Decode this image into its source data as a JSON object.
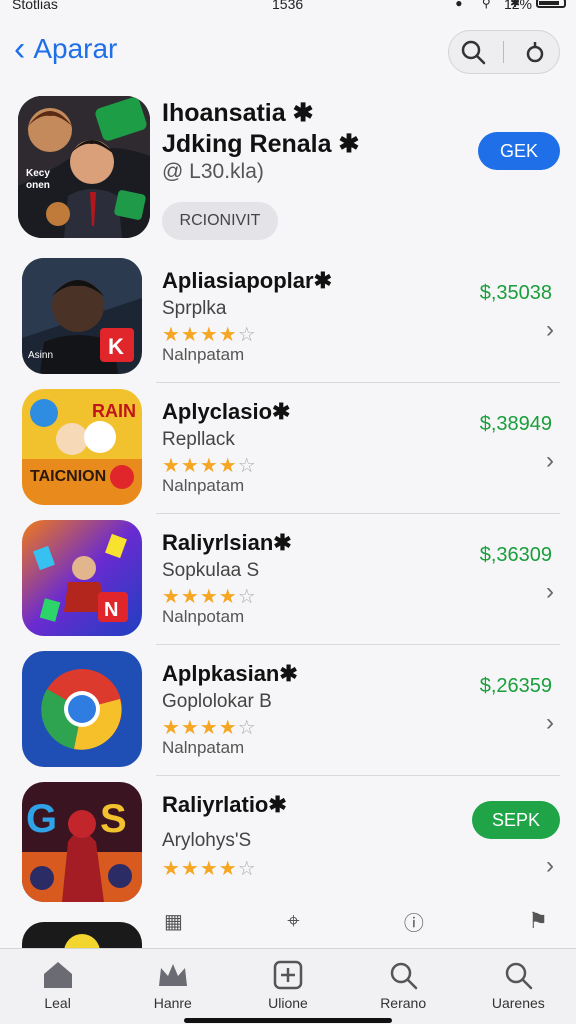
{
  "status_bar": {
    "carrier": "Stotlias",
    "time": "1536",
    "battery": "12%"
  },
  "nav": {
    "back_label": "Aparar",
    "search_icon": "search-icon",
    "account_icon": "account-icon"
  },
  "featured": {
    "title_line1": "Ihoansatia ✱",
    "title_line2": "Jdking Renala ✱",
    "subtitle": "@ L30.kla)",
    "tag": "RCIONIVIT",
    "get_label": "GEK",
    "get_color": "#1e6fe8"
  },
  "apps": [
    {
      "name": "Apliasiapoplar✱",
      "developer": "Sprplka",
      "rating": 4,
      "category": "Nalnpatam",
      "price": "$,35038"
    },
    {
      "name": "Aplyclasio✱",
      "developer": "Repllack",
      "rating": 4,
      "category": "Nalnpatam",
      "price": "$,38949"
    },
    {
      "name": "Raliyrlsian✱",
      "developer": "Sopkulaa S",
      "rating": 4,
      "category": "Nalnpotam",
      "price": "$,36309"
    },
    {
      "name": "Aplpkasian✱",
      "developer": "Goplolokar B",
      "rating": 4,
      "category": "Nalnpatam",
      "price": "$,26359"
    },
    {
      "name": "Raliyrlatio✱",
      "developer": "Arylohys'S",
      "rating": 4,
      "category": "",
      "price": "",
      "get_label": "SEPK",
      "get_color": "#1fa548"
    }
  ],
  "tabs": [
    {
      "label": "Leal",
      "icon": "home-icon"
    },
    {
      "label": "Hanre",
      "icon": "crown-icon"
    },
    {
      "label": "Ulione",
      "icon": "add-square-icon"
    },
    {
      "label": "Rerano",
      "icon": "search-icon"
    },
    {
      "label": "Uarenes",
      "icon": "search-alt-icon"
    }
  ]
}
